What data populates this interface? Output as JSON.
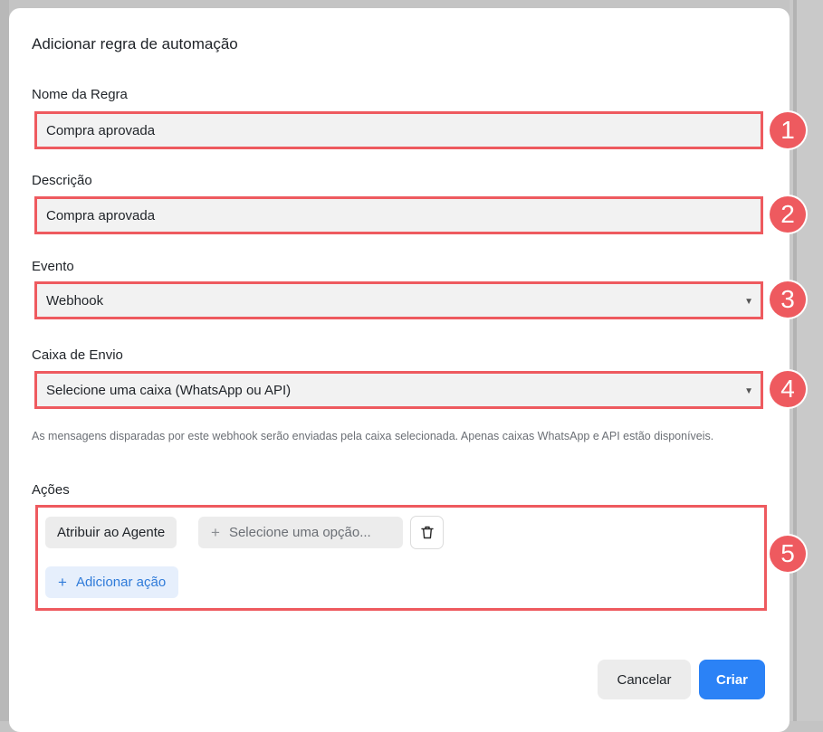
{
  "modal": {
    "title": "Adicionar regra de automação"
  },
  "fields": {
    "rule_name": {
      "label": "Nome da Regra",
      "value": "Compra aprovada",
      "marker": "1"
    },
    "description": {
      "label": "Descrição",
      "value": "Compra aprovada",
      "marker": "2"
    },
    "event": {
      "label": "Evento",
      "value": "Webhook",
      "marker": "3"
    },
    "inbox": {
      "label": "Caixa de Envio",
      "placeholder": "Selecione uma caixa (WhatsApp ou API)",
      "marker": "4",
      "help": "As mensagens disparadas por este webhook serão enviadas pela caixa selecionada. Apenas caixas WhatsApp e API estão disponíveis."
    }
  },
  "actions": {
    "label": "Ações",
    "marker": "5",
    "action_type": "Atribuir ao Agente",
    "option_placeholder": "Selecione uma opção...",
    "add_label": "Adicionar ação"
  },
  "footer": {
    "cancel_label": "Cancelar",
    "create_label": "Criar"
  },
  "colors": {
    "highlight": "#ee5a5f",
    "primary": "#2b82f6",
    "add_action_bg": "#e6effc"
  },
  "icons": {
    "dropdown": "caret-down-icon",
    "plus": "plus-icon",
    "delete": "trash-icon"
  }
}
